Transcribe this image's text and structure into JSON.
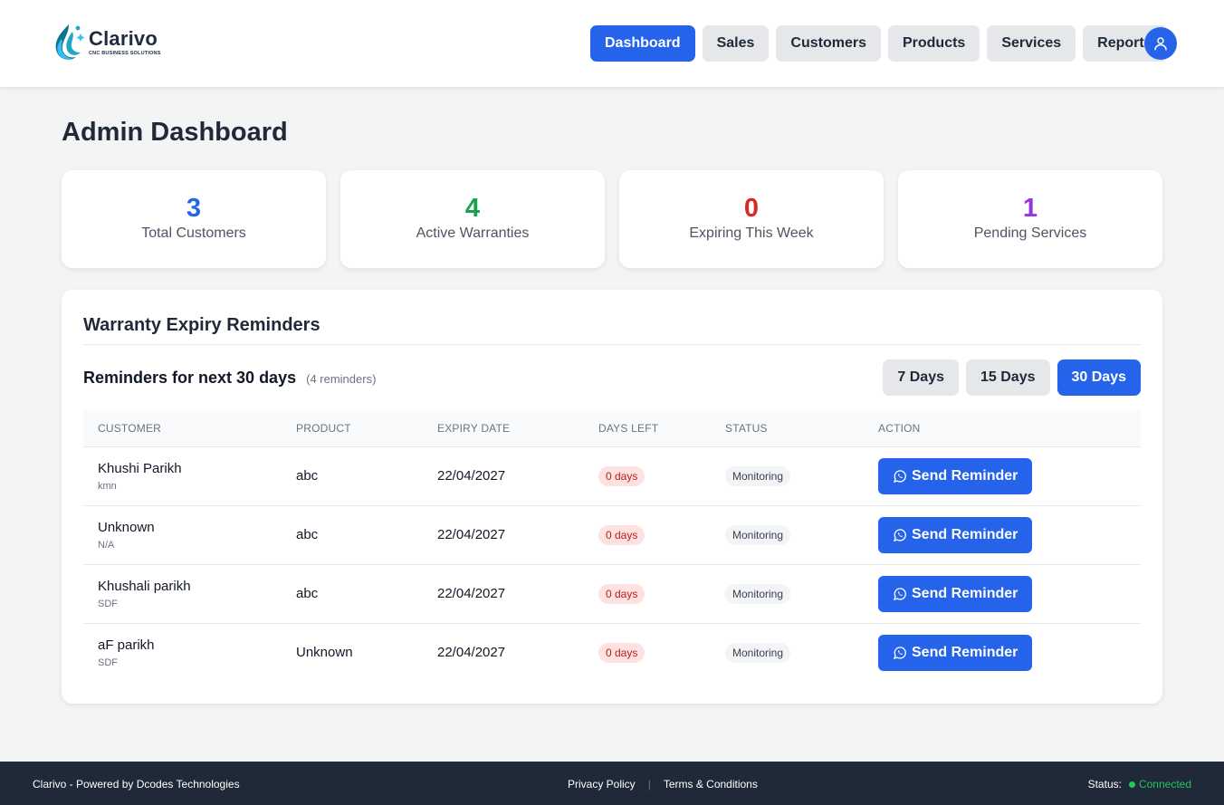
{
  "brand": {
    "name": "Clarivo",
    "tagline": "CNC BUSINESS SOLUTIONS"
  },
  "nav": {
    "items": [
      {
        "label": "Dashboard",
        "active": true
      },
      {
        "label": "Sales",
        "active": false
      },
      {
        "label": "Customers",
        "active": false
      },
      {
        "label": "Products",
        "active": false
      },
      {
        "label": "Services",
        "active": false
      },
      {
        "label": "Reports",
        "active": false
      }
    ],
    "profile_icon": "user-icon"
  },
  "page": {
    "title": "Admin Dashboard"
  },
  "stats": [
    {
      "value": "3",
      "label": "Total Customers",
      "color": "#2563eb"
    },
    {
      "value": "4",
      "label": "Active Warranties",
      "color": "#16a34a"
    },
    {
      "value": "0",
      "label": "Expiring This Week",
      "color": "#dc2626"
    },
    {
      "value": "1",
      "label": "Pending Services",
      "color": "#9333ea"
    }
  ],
  "reminders": {
    "title": "Warranty Expiry Reminders",
    "subtitle": "Reminders for next 30 days",
    "count_text": "(4 reminders)",
    "ranges": [
      {
        "label": "7 Days",
        "active": false
      },
      {
        "label": "15 Days",
        "active": false
      },
      {
        "label": "30 Days",
        "active": true
      }
    ],
    "columns": [
      "CUSTOMER",
      "PRODUCT",
      "EXPIRY DATE",
      "DAYS LEFT",
      "STATUS",
      "ACTION"
    ],
    "rows": [
      {
        "name": "Khushi Parikh",
        "sub": "kmn",
        "product": "abc",
        "expiry": "22/04/2027",
        "days_left": "0 days",
        "status": "Monitoring",
        "action": "Send Reminder"
      },
      {
        "name": "Unknown",
        "sub": "N/A",
        "product": "abc",
        "expiry": "22/04/2027",
        "days_left": "0 days",
        "status": "Monitoring",
        "action": "Send Reminder"
      },
      {
        "name": "Khushali parikh",
        "sub": "SDF",
        "product": "abc",
        "expiry": "22/04/2027",
        "days_left": "0 days",
        "status": "Monitoring",
        "action": "Send Reminder"
      },
      {
        "name": "aF parikh",
        "sub": "SDF",
        "product": "Unknown",
        "expiry": "22/04/2027",
        "days_left": "0 days",
        "status": "Monitoring",
        "action": "Send Reminder"
      }
    ],
    "action_icon": "whatsapp-icon"
  },
  "footer": {
    "left": "Clarivo - Powered by Dcodes Technologies",
    "links": [
      "Privacy Policy",
      "Terms & Conditions"
    ],
    "status_label": "Status:",
    "status_value": "Connected"
  },
  "colors": {
    "primary": "#2563eb",
    "footer_bg": "#1f2937",
    "connected": "#22c55e"
  }
}
